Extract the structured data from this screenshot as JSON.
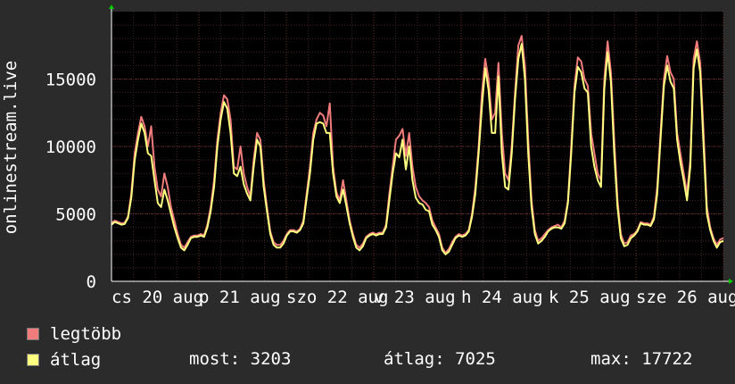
{
  "chart_data": {
    "type": "line",
    "ylabel": "onlinestream.live",
    "ylim": [
      0,
      20000
    ],
    "y_ticks": [
      0,
      5000,
      10000,
      15000
    ],
    "y_tick_labels": [
      "0",
      "5000",
      "10000",
      "15000"
    ],
    "x_tick_labels": [
      "cs 20 aug",
      "p 21 aug",
      "szo 22 aug",
      "v 23 aug",
      "h 24 aug",
      "k 25 aug",
      "sze 26 aug"
    ],
    "series": [
      {
        "name": "legtöbb",
        "color": "#f07c7c",
        "values": [
          4350,
          4500,
          4400,
          4300,
          4350,
          4800,
          6500,
          9500,
          11000,
          12200,
          11500,
          10000,
          11500,
          8500,
          6800,
          6300,
          8000,
          7000,
          5500,
          4500,
          3500,
          2700,
          2500,
          2900,
          3300,
          3400,
          3400,
          3500,
          3400,
          4200,
          5500,
          7500,
          10500,
          12500,
          13800,
          13500,
          12000,
          8500,
          8300,
          10000,
          8000,
          7000,
          6300,
          9000,
          11000,
          10500,
          7500,
          5500,
          3700,
          2900,
          2700,
          2700,
          3000,
          3500,
          3800,
          3800,
          3700,
          3900,
          4500,
          6500,
          8500,
          11000,
          12000,
          12500,
          12300,
          11500,
          13200,
          8500,
          6600,
          6000,
          7500,
          6000,
          4500,
          3500,
          2700,
          2500,
          2800,
          3300,
          3500,
          3600,
          3500,
          3600,
          3600,
          4200,
          6500,
          8500,
          10500,
          10800,
          11300,
          9300,
          11000,
          8500,
          7000,
          6300,
          6000,
          5800,
          5500,
          4500,
          4000,
          3500,
          2500,
          2100,
          2400,
          2900,
          3300,
          3500,
          3400,
          3500,
          3800,
          5000,
          7000,
          10000,
          14000,
          16500,
          15000,
          12000,
          12500,
          16200,
          11000,
          8000,
          7500,
          10000,
          14000,
          17500,
          18200,
          16000,
          10500,
          6000,
          3800,
          3000,
          3200,
          3500,
          3800,
          4000,
          4100,
          4200,
          4000,
          4500,
          6000,
          10000,
          14500,
          16600,
          16300,
          15000,
          14500,
          11000,
          9500,
          8000,
          7500,
          15000,
          17800,
          15500,
          10500,
          6000,
          3500,
          2800,
          2900,
          3400,
          3500,
          3800,
          4400,
          4300,
          4300,
          4200,
          4800,
          7000,
          11000,
          15000,
          16700,
          15500,
          15000,
          11000,
          9500,
          8000,
          6500,
          9000,
          16500,
          17800,
          16200,
          11000,
          5500,
          4000,
          3200,
          2700,
          3100,
          3200
        ]
      },
      {
        "name": "átlag",
        "color": "#ffff80",
        "values": [
          4200,
          4400,
          4300,
          4200,
          4250,
          4700,
          6200,
          9000,
          10500,
          11700,
          11000,
          9500,
          9300,
          7500,
          5800,
          5500,
          6800,
          6000,
          5000,
          4000,
          3200,
          2500,
          2300,
          2700,
          3200,
          3300,
          3300,
          3400,
          3300,
          4000,
          5200,
          7000,
          10000,
          12000,
          13300,
          12800,
          11000,
          8000,
          7800,
          8500,
          7200,
          6500,
          6000,
          8500,
          10500,
          10000,
          7000,
          5200,
          3500,
          2700,
          2500,
          2500,
          2800,
          3400,
          3700,
          3700,
          3600,
          3800,
          4300,
          6200,
          8000,
          10500,
          11700,
          11800,
          11700,
          11000,
          11000,
          8000,
          6300,
          5800,
          6800,
          5600,
          4300,
          3300,
          2500,
          2300,
          2600,
          3200,
          3400,
          3500,
          3400,
          3500,
          3500,
          4000,
          6000,
          8000,
          9500,
          9200,
          10500,
          8300,
          10000,
          7500,
          6200,
          5800,
          5700,
          5300,
          5200,
          4200,
          3800,
          3300,
          2300,
          2000,
          2200,
          2700,
          3200,
          3400,
          3300,
          3400,
          3700,
          4800,
          6500,
          9500,
          13000,
          15800,
          14200,
          11000,
          11000,
          15200,
          9500,
          7000,
          6800,
          9500,
          13500,
          16500,
          17600,
          15000,
          9500,
          5500,
          3500,
          2800,
          3000,
          3300,
          3700,
          3900,
          4000,
          4000,
          3900,
          4300,
          5800,
          9500,
          14000,
          15900,
          15500,
          14300,
          14000,
          10000,
          8500,
          7500,
          7000,
          14300,
          17000,
          14800,
          9500,
          5500,
          3200,
          2600,
          2700,
          3200,
          3400,
          3700,
          4300,
          4200,
          4200,
          4100,
          4600,
          6500,
          10500,
          14500,
          16000,
          14800,
          14300,
          10500,
          8800,
          7500,
          6000,
          8500,
          15800,
          17200,
          15500,
          10000,
          5000,
          3800,
          3000,
          2500,
          2900,
          3000
        ]
      }
    ],
    "grid": true
  },
  "legend": [
    {
      "label": "legtöbb",
      "color": "#f07c7c"
    },
    {
      "label": "átlag",
      "color": "#ffff80"
    }
  ],
  "stats": {
    "most": "most: 3203",
    "atlag": "átlag: 7025",
    "max": "max: 17722"
  }
}
